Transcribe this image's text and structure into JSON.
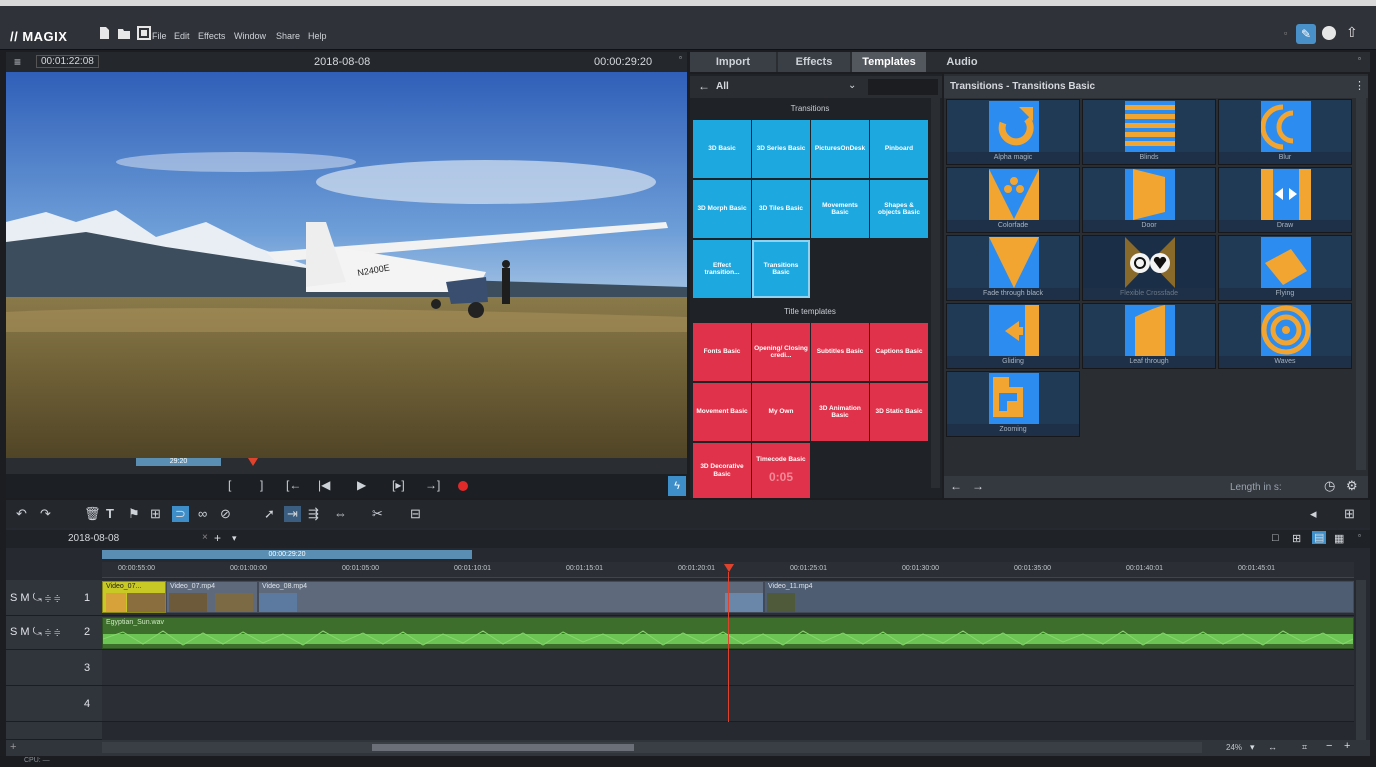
{
  "app": {
    "logo": "// MAGIX",
    "menu": [
      "File",
      "Edit",
      "Effects",
      "Window",
      "Share",
      "Help"
    ]
  },
  "preview": {
    "timecode_left": "00:01:22:08",
    "title": "2018-08-08",
    "timecode_right": "00:00:29:20",
    "scrub_label": "29:20",
    "controls": [
      "[",
      "]",
      "[←",
      "|◀",
      "▶",
      "[▸]",
      "→]"
    ]
  },
  "tabs": [
    "Import",
    "Effects",
    "Templates",
    "Audio"
  ],
  "active_tab": "Templates",
  "category_pane": {
    "filter": "All",
    "transitions_heading": "Transitions",
    "transitions": [
      "3D Basic",
      "3D Series Basic",
      "PicturesOnDesk",
      "Pinboard",
      "3D Morph Basic",
      "3D Tiles Basic",
      "Movements Basic",
      "Shapes & objects Basic",
      "Effect transition...",
      "Transitions Basic"
    ],
    "titles_heading": "Title templates",
    "titles": [
      "Fonts Basic",
      "Opening/ Closing credi...",
      "Subtitles Basic",
      "Captions Basic",
      "Movement Basic",
      "My Own",
      "3D Animation Basic",
      "3D Static Basic",
      "3D Decorative Basic",
      "Timecode Basic"
    ],
    "timecode_overlay": "0:05"
  },
  "effects_pane": {
    "header": "Transitions - Transitions Basic",
    "items": [
      "Alpha magic",
      "Blinds",
      "Blur",
      "Colorfade",
      "Door",
      "Draw",
      "Fade through black",
      "Flexible Crossfade",
      "Flying",
      "Gliding",
      "Leaf through",
      "Waves",
      "Zooming"
    ],
    "length_label": "Length in s:"
  },
  "timeline": {
    "tab": "2018-08-08",
    "range_label": "00:00:29:20",
    "ruler": [
      "00:00:55:00",
      "00:01:00:00",
      "00:01:05:00",
      "00:01:10:01",
      "00:01:15:01",
      "00:01:20:01",
      "00:01:25:01",
      "00:01:30:00",
      "00:01:35:00",
      "00:01:40:01",
      "00:01:45:01"
    ],
    "tracks": [
      {
        "controls": "S M ⤿ ≑ ≑",
        "number": "1"
      },
      {
        "controls": "S M ⤿ ≑ ≑",
        "number": "2"
      },
      {
        "controls": "",
        "number": "3"
      },
      {
        "controls": "",
        "number": "4"
      }
    ],
    "clips": {
      "c1": "Video_07...",
      "c2": "Video_07.mp4",
      "c3": "Video_08.mp4",
      "c4": "Video_11.mp4",
      "audio": "Egyptian_Sun.wav"
    },
    "zoom": "24%"
  },
  "status": "CPU: —",
  "colors": {
    "accent_blue": "#1ea8e0",
    "accent_red": "#e0324a",
    "fx_orange": "#f2a531",
    "fx_blue": "#2d8cf0",
    "audio_green": "#5fb248",
    "playhead": "#e0432d"
  }
}
